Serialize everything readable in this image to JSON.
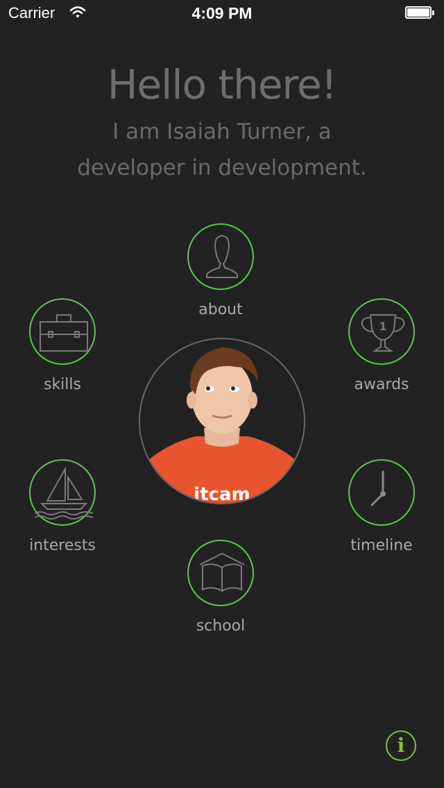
{
  "status_bar": {
    "carrier": "Carrier",
    "time": "4:09 PM"
  },
  "header": {
    "greeting": "Hello there!",
    "intro_line1": "I am Isaiah Turner, a",
    "intro_line2": "developer in development."
  },
  "nav": {
    "about": "about",
    "skills": "skills",
    "awards": "awards",
    "interests": "interests",
    "timeline": "timeline",
    "school": "school"
  },
  "info_button": {
    "glyph": "i"
  },
  "colors": {
    "background": "#222222",
    "accent_green": "#58c94a",
    "info_green": "#7cc63a",
    "text_gray": "#6e6e6e",
    "label_gray": "#a9a9a9"
  }
}
